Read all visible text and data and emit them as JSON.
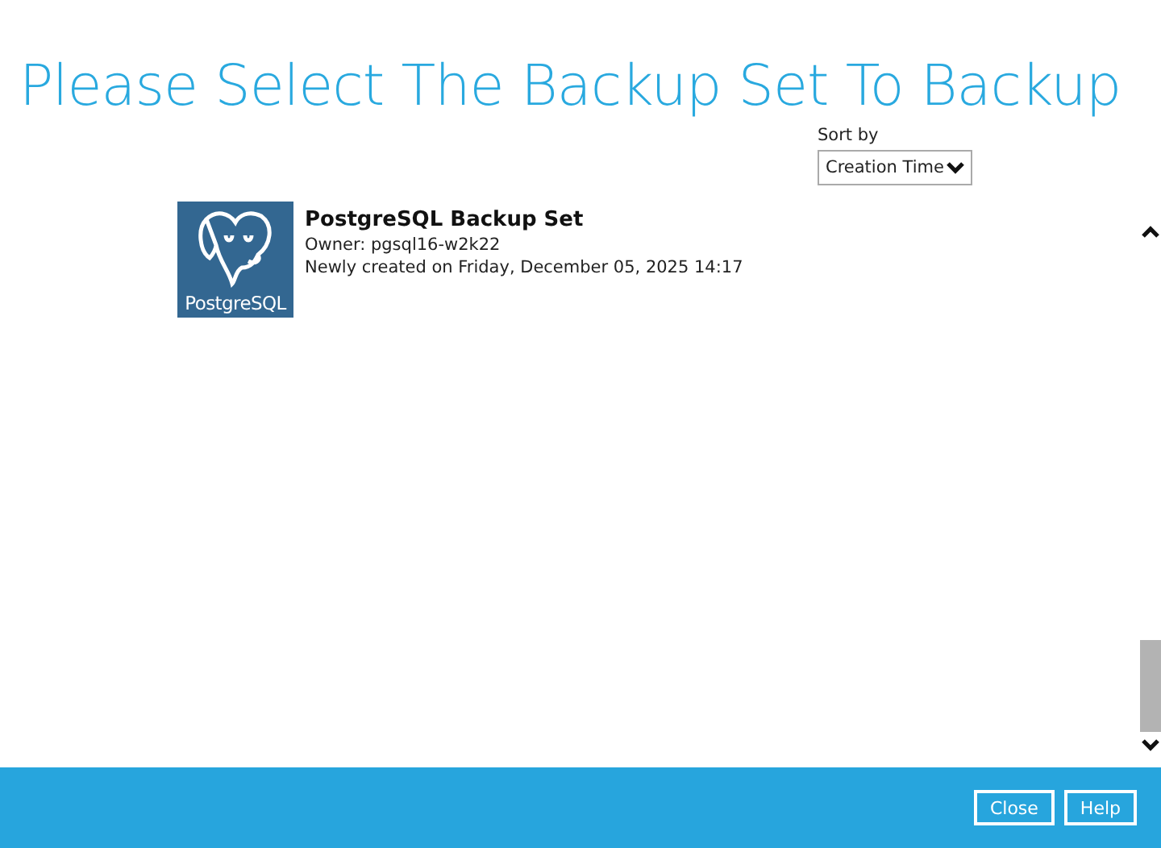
{
  "title": "Please Select The Backup Set To Backup",
  "sort": {
    "label": "Sort by",
    "value": "Creation Time"
  },
  "backup_sets": [
    {
      "logo_text": "PostgreSQL",
      "name": "PostgreSQL Backup Set",
      "owner": "Owner: pgsql16-w2k22",
      "created": "Newly created on Friday, December 05, 2025 14:17",
      "selected": false
    }
  ],
  "buttons": [
    "Close",
    "Help"
  ]
}
